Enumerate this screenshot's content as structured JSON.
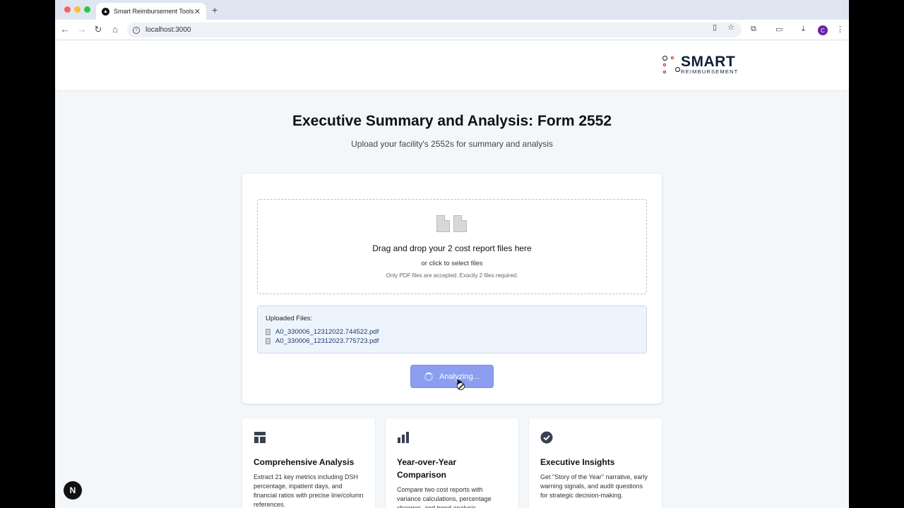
{
  "browser": {
    "tab_title": "Smart Reimbursement Tools",
    "tab_close": "✕",
    "new_tab": "+",
    "url": "localhost:3000",
    "avatar_letter": "C"
  },
  "logo": {
    "main": "SMART",
    "sub": "REIMBURSEMENT"
  },
  "page": {
    "title": "Executive Summary and Analysis: Form 2552",
    "subtitle": "Upload your facility's 2552s for summary and analysis"
  },
  "dropzone": {
    "title": "Drag and drop your 2 cost report files here",
    "subtitle": "or click to select files",
    "note": "Only PDF files are accepted. Exactly 2 files required."
  },
  "uploaded": {
    "label": "Uploaded Files:",
    "files": [
      "A0_330006_12312022.744522.pdf",
      "A0_330006_12312023.775723.pdf"
    ]
  },
  "analyze_button": {
    "label": "Analyzing..."
  },
  "features": [
    {
      "icon": "layout-icon",
      "title": "Comprehensive Analysis",
      "desc": "Extract 21 key metrics including DSH percentage, inpatient days, and financial ratios with precise line/column references."
    },
    {
      "icon": "bar-chart-icon",
      "title": "Year-over-Year Comparison",
      "desc": "Compare two cost reports with variance calculations, percentage changes, and trend analysis."
    },
    {
      "icon": "check-circle-icon",
      "title": "Executive Insights",
      "desc": "Get \"Story of the Year\" narrative, early warning signals, and audit questions for strategic decision-making."
    }
  ],
  "dev_badge": "N",
  "colors": {
    "button": "#8b9ef0",
    "uploaded_bg": "#eef4fc",
    "page_bg": "#f4f7f9",
    "logo_navy": "#0f1f3a"
  }
}
